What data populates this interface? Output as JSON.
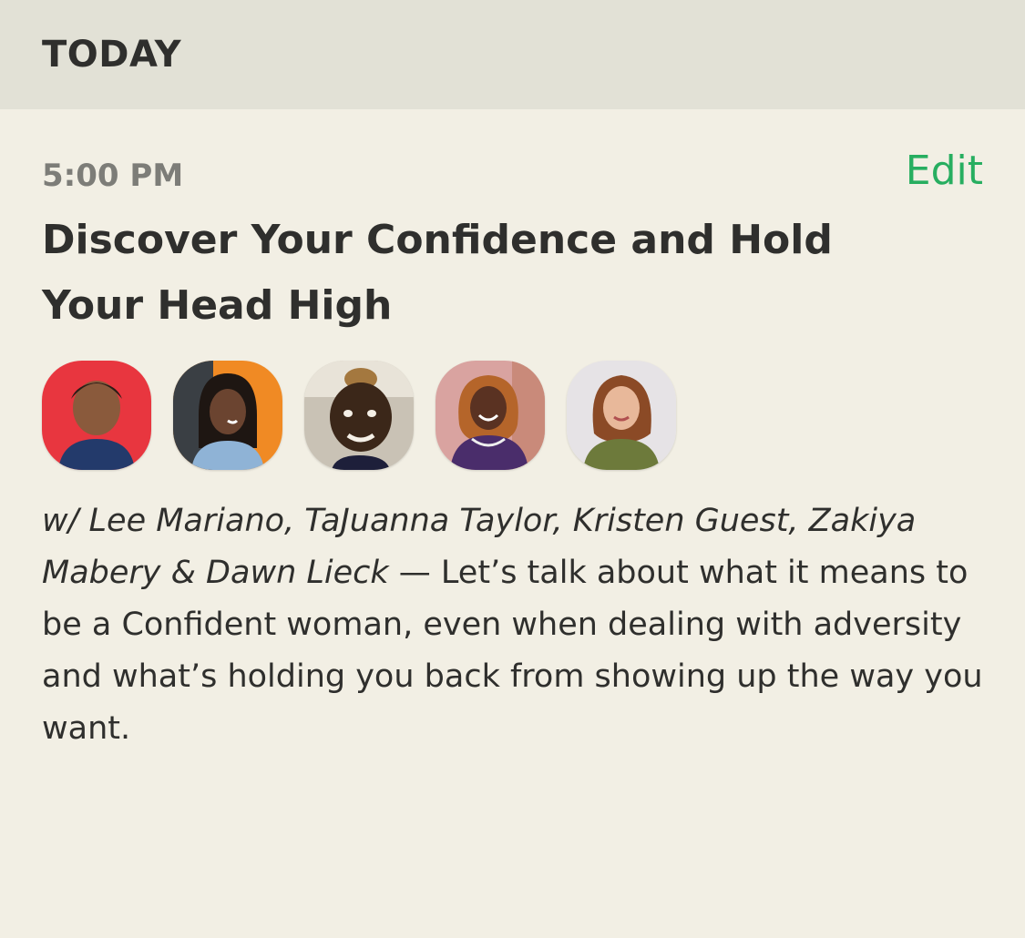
{
  "section": {
    "label": "TODAY"
  },
  "event": {
    "time": "5:00 PM",
    "edit_label": "Edit",
    "title": "Discover Your Confidence and Hold Your Head High",
    "hosts_text": "w/ Lee Mariano, TaJuanna Taylor, Kristen Guest, Zakiya Mabery & Dawn Lieck",
    "separator": " — ",
    "description": "Let’s talk about what it means to be a Confident woman, even when dealing with adversity and what’s holding you back from showing up the way you want.",
    "avatars": [
      {
        "icon": "avatar-photo",
        "background": "#e8363f"
      },
      {
        "icon": "avatar-photo",
        "background": "#f08a24"
      },
      {
        "icon": "avatar-photo",
        "background": "#c9c2b5"
      },
      {
        "icon": "avatar-photo",
        "background": "#d9a3a0"
      },
      {
        "icon": "avatar-photo",
        "background": "#e6e3e6"
      }
    ]
  },
  "colors": {
    "page_background": "#f2efe4",
    "header_background": "#e2e1d6",
    "accent_green": "#27ae60",
    "time_gray": "#7d7d78",
    "text_dark": "#2f2f2d"
  }
}
